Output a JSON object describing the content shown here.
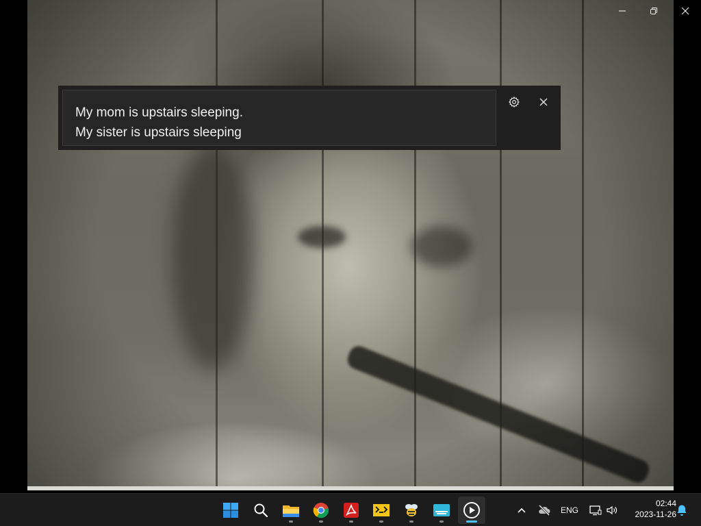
{
  "window": {
    "minimize_icon": "minimize-icon",
    "restore_icon": "restore-icon",
    "close_icon": "close-icon"
  },
  "caption": {
    "line1": "My mom is upstairs sleeping.",
    "line2": "My sister is upstairs sleeping",
    "settings_icon": "gear-icon",
    "close_icon": "close-icon"
  },
  "taskbar": {
    "apps": [
      {
        "name": "start",
        "icon": "windows-logo-icon"
      },
      {
        "name": "search",
        "icon": "search-icon"
      },
      {
        "name": "file-explorer",
        "icon": "folder-icon"
      },
      {
        "name": "chrome",
        "icon": "chrome-icon"
      },
      {
        "name": "acrobat",
        "icon": "acrobat-icon"
      },
      {
        "name": "app-yellow",
        "icon": "yellow-app-icon"
      },
      {
        "name": "app-bee",
        "icon": "bee-icon"
      },
      {
        "name": "captions-app",
        "icon": "captions-icon"
      },
      {
        "name": "media-player",
        "icon": "media-player-icon"
      }
    ],
    "tray": {
      "chevron_icon": "chevron-up-icon",
      "network_off_icon": "cloud-off-icon",
      "language": "ENG",
      "display_icon": "network-icon",
      "volume_icon": "volume-icon",
      "time": "02:44",
      "date": "2023-11-26",
      "notification_icon": "bell-icon"
    },
    "accent_color": "#4cc2ff"
  }
}
